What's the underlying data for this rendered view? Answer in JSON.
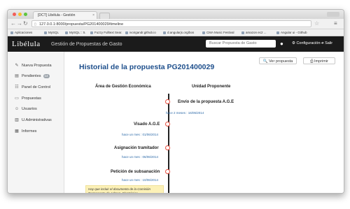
{
  "browser": {
    "tab_title": "[DCT] Libélula - Gestión",
    "tab_close": "×",
    "url": "127.0.0.1:8000/propuesta/PG201400029/timeline",
    "back": "←",
    "forward": "→",
    "reload": "↻",
    "star": "☆",
    "menu": "≡",
    "bookmarks": [
      "Aplicaciones",
      "MySQL",
      "MySQL :: 5.",
      "Fuzzy Fulltext Sear.",
      "ivoirgandr.github.io",
      "d.angularjs.org/bos",
      "CMA Music Festival",
      "amazon ec2 ...",
      "Angular ui - Github"
    ]
  },
  "header": {
    "brand": "Libélula",
    "subtitle": "Gestión de Propuestas de Gasto",
    "search_placeholder": "Buscar Propuesta de Gasto",
    "github_icon": "github-icon",
    "config_label": "⚙ Configuración",
    "logout_label": "➜ Salir"
  },
  "sidebar": {
    "items": [
      {
        "icon": "✎",
        "label": "Nueva Propuesta"
      },
      {
        "icon": "▤",
        "label": "Pendientes",
        "badge": "14"
      },
      {
        "icon": "☷",
        "label": "Panel de Control"
      },
      {
        "icon": "▭",
        "label": "Propuestas"
      },
      {
        "icon": "☺",
        "label": "Usuarios"
      },
      {
        "icon": "▥",
        "label": "U.Administrativas"
      },
      {
        "icon": "▦",
        "label": "Informes"
      }
    ]
  },
  "main": {
    "title": "Historial de la propuesta PG201400029",
    "view_button": "🔍 Ver propuesta",
    "print_button": "⎙ Imprimir",
    "col_left": "Área de Gestión Económica",
    "col_right": "Unidad Proponente",
    "events": [
      {
        "title": "Envío de la propuesta A.G.E",
        "date": "hace 2 meses : 16/05/2014"
      },
      {
        "title": "Visado A.G.E",
        "date": "hace un mes : 01/06/2014"
      },
      {
        "title": "Asignación tramitador",
        "date": "hace un mes : 06/06/2014"
      },
      {
        "title": "Petición de subsanación",
        "date": "hace un mes : 10/06/2014"
      }
    ],
    "note": "Hay que incluir el documento de la Comisión Permanente de Admon. Electrónica"
  }
}
